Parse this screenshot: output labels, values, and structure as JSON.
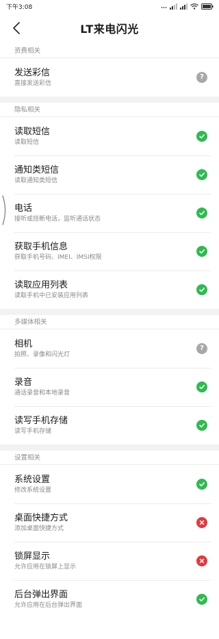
{
  "status_bar": {
    "time": "下午3:08",
    "icons": [
      "ellipsis-icon",
      "signal-icon",
      "signal-icon",
      "wifi-icon",
      "battery-icon"
    ]
  },
  "header": {
    "title": "LT来电闪光",
    "back_icon": "back-arrow-icon"
  },
  "colors": {
    "granted": "#2cbc4f",
    "denied": "#e8363b",
    "unknown": "#a8a8a8",
    "section_bg": "#f2f2f2"
  },
  "sections": [
    {
      "header": "资费相关",
      "items": [
        {
          "title": "发送彩信",
          "desc": "直接发送彩信",
          "status": "unknown"
        }
      ]
    },
    {
      "header": "隐私相关",
      "items": [
        {
          "title": "读取短信",
          "desc": "读取短信",
          "status": "granted"
        },
        {
          "title": "通知类短信",
          "desc": "读取通知类短信",
          "status": "granted"
        },
        {
          "title": "电话",
          "desc": "接听或挂断电话，监听通话状态",
          "status": "granted"
        },
        {
          "title": "获取手机信息",
          "desc": "获取手机号码、IMEI、IMSI权限",
          "status": "granted"
        },
        {
          "title": "读取应用列表",
          "desc": "读取手机中已安装应用列表",
          "status": "granted"
        }
      ]
    },
    {
      "header": "多媒体相关",
      "items": [
        {
          "title": "相机",
          "desc": "拍照、录像和闪光灯",
          "status": "unknown"
        },
        {
          "title": "录音",
          "desc": "通话录音和本地录音",
          "status": "granted"
        },
        {
          "title": "读写手机存储",
          "desc": "读写手机存储",
          "status": "granted"
        }
      ]
    },
    {
      "header": "设置相关",
      "items": [
        {
          "title": "系统设置",
          "desc": "修改系统设置",
          "status": "granted"
        },
        {
          "title": "桌面快捷方式",
          "desc": "添加桌面快捷方式",
          "status": "denied"
        },
        {
          "title": "锁屏显示",
          "desc": "允许应用在锁屏上显示",
          "status": "denied"
        },
        {
          "title": "后台弹出界面",
          "desc": "允许应用在后台弹出界面",
          "status": "granted"
        }
      ]
    }
  ]
}
